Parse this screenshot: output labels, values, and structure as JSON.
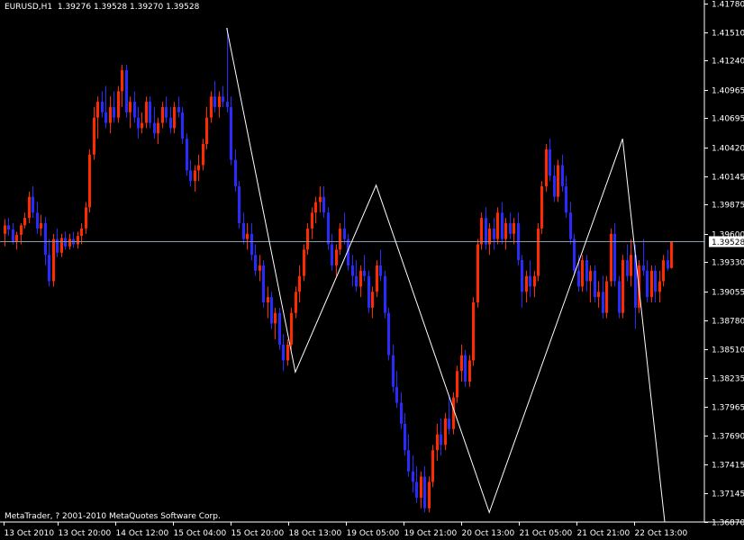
{
  "header": {
    "symbol_timeframe": "EURUSD,H1",
    "ohlc": "1.39276 1.39528 1.39270 1.39528"
  },
  "copyright": "MetaTrader, ? 2001-2010 MetaQuotes Software Corp.",
  "current_price_label": "1.39528",
  "colors": {
    "background": "#000000",
    "bull_candle": "#ff2a00",
    "bear_candle": "#2a2aff",
    "zigzag": "#ffffff",
    "price_line": "#8899aa",
    "axis": "#ffffff"
  },
  "chart_data": {
    "type": "candlestick",
    "symbol": "EURUSD",
    "timeframe": "H1",
    "ylim": [
      1.3687,
      1.4178
    ],
    "y_ticks": [
      "1.41780",
      "1.41510",
      "1.41240",
      "1.40965",
      "1.40695",
      "1.40420",
      "1.40145",
      "1.39875",
      "1.39600",
      "1.39330",
      "1.39055",
      "1.38780",
      "1.38510",
      "1.38235",
      "1.37965",
      "1.37690",
      "1.37415",
      "1.37145",
      "1.36870"
    ],
    "x_ticks": [
      "13 Oct 2010",
      "13 Oct 20:00",
      "14 Oct 12:00",
      "15 Oct 04:00",
      "15 Oct 20:00",
      "18 Oct 13:00",
      "19 Oct 05:00",
      "19 Oct 21:00",
      "20 Oct 13:00",
      "21 Oct 05:00",
      "21 Oct 21:00",
      "22 Oct 13:00"
    ],
    "current_price": 1.39528,
    "zigzag": [
      {
        "time": "15 Oct 04:00",
        "price": 1.4155
      },
      {
        "time": "15 Oct 22:00",
        "price": 1.3829
      },
      {
        "time": "18 Oct 14:00",
        "price": 1.4006
      },
      {
        "time": "19 Oct 22:00",
        "price": 1.3696
      },
      {
        "time": "21 Oct 06:00",
        "price": 1.405
      },
      {
        "time": "22 Oct 14:00",
        "price": 1.3687
      }
    ],
    "candles": [
      [
        1.396,
        1.3974,
        1.3948,
        1.3968
      ],
      [
        1.3968,
        1.3975,
        1.3958,
        1.3964
      ],
      [
        1.3964,
        1.397,
        1.395,
        1.3952
      ],
      [
        1.3952,
        1.3962,
        1.3945,
        1.3959
      ],
      [
        1.3959,
        1.397,
        1.395,
        1.3968
      ],
      [
        1.3968,
        1.398,
        1.3965,
        1.3975
      ],
      [
        1.3975,
        1.4,
        1.397,
        1.3995
      ],
      [
        1.3995,
        1.4005,
        1.3975,
        1.398
      ],
      [
        1.398,
        1.399,
        1.396,
        1.3965
      ],
      [
        1.3965,
        1.3978,
        1.3958,
        1.397
      ],
      [
        1.397,
        1.3976,
        1.393,
        1.394
      ],
      [
        1.394,
        1.3955,
        1.391,
        1.3915
      ],
      [
        1.3915,
        1.396,
        1.391,
        1.3955
      ],
      [
        1.3955,
        1.3965,
        1.3938,
        1.3942
      ],
      [
        1.3942,
        1.396,
        1.3938,
        1.3956
      ],
      [
        1.3956,
        1.3962,
        1.3945,
        1.3948
      ],
      [
        1.3948,
        1.396,
        1.3945,
        1.3955
      ],
      [
        1.3955,
        1.3962,
        1.3947,
        1.395
      ],
      [
        1.395,
        1.3962,
        1.3946,
        1.3958
      ],
      [
        1.3958,
        1.397,
        1.395,
        1.3965
      ],
      [
        1.3965,
        1.399,
        1.396,
        1.3985
      ],
      [
        1.3985,
        1.404,
        1.398,
        1.4035
      ],
      [
        1.4035,
        1.408,
        1.403,
        1.407
      ],
      [
        1.407,
        1.409,
        1.405,
        1.4085
      ],
      [
        1.4085,
        1.4095,
        1.407,
        1.4075
      ],
      [
        1.4075,
        1.41,
        1.406,
        1.4065
      ],
      [
        1.4065,
        1.409,
        1.4055,
        1.408
      ],
      [
        1.408,
        1.4095,
        1.4065,
        1.407
      ],
      [
        1.407,
        1.41,
        1.4065,
        1.4095
      ],
      [
        1.4095,
        1.412,
        1.408,
        1.4115
      ],
      [
        1.4115,
        1.412,
        1.407,
        1.4075
      ],
      [
        1.4075,
        1.409,
        1.406,
        1.4085
      ],
      [
        1.4085,
        1.4095,
        1.4065,
        1.407
      ],
      [
        1.407,
        1.408,
        1.405,
        1.406
      ],
      [
        1.406,
        1.4075,
        1.4055,
        1.4065
      ],
      [
        1.4065,
        1.409,
        1.406,
        1.4085
      ],
      [
        1.4085,
        1.409,
        1.406,
        1.4065
      ],
      [
        1.4065,
        1.408,
        1.405,
        1.4055
      ],
      [
        1.4055,
        1.407,
        1.4045,
        1.4065
      ],
      [
        1.4065,
        1.4085,
        1.406,
        1.408
      ],
      [
        1.408,
        1.409,
        1.4065,
        1.407
      ],
      [
        1.407,
        1.408,
        1.4055,
        1.406
      ],
      [
        1.406,
        1.4085,
        1.4055,
        1.408
      ],
      [
        1.408,
        1.409,
        1.407,
        1.4075
      ],
      [
        1.4075,
        1.408,
        1.4045,
        1.405
      ],
      [
        1.405,
        1.4055,
        1.4015,
        1.402
      ],
      [
        1.402,
        1.403,
        1.4005,
        1.401
      ],
      [
        1.401,
        1.4025,
        1.4,
        1.402
      ],
      [
        1.402,
        1.4035,
        1.401,
        1.4025
      ],
      [
        1.4025,
        1.405,
        1.402,
        1.4045
      ],
      [
        1.4045,
        1.408,
        1.404,
        1.407
      ],
      [
        1.407,
        1.4095,
        1.4065,
        1.409
      ],
      [
        1.409,
        1.4105,
        1.4075,
        1.408
      ],
      [
        1.408,
        1.4095,
        1.407,
        1.409
      ],
      [
        1.409,
        1.41,
        1.408,
        1.4085
      ],
      [
        1.4085,
        1.4155,
        1.4075,
        1.408
      ],
      [
        1.408,
        1.409,
        1.4025,
        1.403
      ],
      [
        1.403,
        1.404,
        1.4,
        1.4005
      ],
      [
        1.4005,
        1.401,
        1.3965,
        1.397
      ],
      [
        1.397,
        1.398,
        1.395,
        1.3955
      ],
      [
        1.3955,
        1.397,
        1.3945,
        1.396
      ],
      [
        1.396,
        1.397,
        1.3935,
        1.394
      ],
      [
        1.394,
        1.395,
        1.392,
        1.3925
      ],
      [
        1.3925,
        1.394,
        1.3915,
        1.393
      ],
      [
        1.393,
        1.3935,
        1.389,
        1.3895
      ],
      [
        1.3895,
        1.391,
        1.388,
        1.39
      ],
      [
        1.39,
        1.3905,
        1.387,
        1.3875
      ],
      [
        1.3875,
        1.389,
        1.386,
        1.3885
      ],
      [
        1.3885,
        1.389,
        1.385,
        1.3855
      ],
      [
        1.3855,
        1.3865,
        1.383,
        1.384
      ],
      [
        1.384,
        1.386,
        1.3835,
        1.3855
      ],
      [
        1.3855,
        1.389,
        1.385,
        1.3885
      ],
      [
        1.3885,
        1.391,
        1.388,
        1.3905
      ],
      [
        1.3905,
        1.393,
        1.3895,
        1.392
      ],
      [
        1.392,
        1.395,
        1.3915,
        1.3945
      ],
      [
        1.3945,
        1.397,
        1.394,
        1.3965
      ],
      [
        1.3965,
        1.3985,
        1.3955,
        1.398
      ],
      [
        1.398,
        1.3995,
        1.397,
        1.399
      ],
      [
        1.399,
        1.4005,
        1.398,
        1.3995
      ],
      [
        1.3995,
        1.4005,
        1.3975,
        1.398
      ],
      [
        1.398,
        1.3985,
        1.3945,
        1.395
      ],
      [
        1.395,
        1.396,
        1.3925,
        1.393
      ],
      [
        1.393,
        1.395,
        1.392,
        1.3945
      ],
      [
        1.3945,
        1.397,
        1.394,
        1.3965
      ],
      [
        1.3965,
        1.398,
        1.395,
        1.3955
      ],
      [
        1.3955,
        1.396,
        1.3925,
        1.393
      ],
      [
        1.393,
        1.394,
        1.391,
        1.392
      ],
      [
        1.392,
        1.3935,
        1.3905,
        1.391
      ],
      [
        1.391,
        1.393,
        1.39,
        1.3925
      ],
      [
        1.3925,
        1.394,
        1.3915,
        1.392
      ],
      [
        1.392,
        1.3925,
        1.3885,
        1.389
      ],
      [
        1.389,
        1.391,
        1.388,
        1.3905
      ],
      [
        1.3905,
        1.3935,
        1.39,
        1.393
      ],
      [
        1.393,
        1.3945,
        1.3915,
        1.392
      ],
      [
        1.392,
        1.3925,
        1.388,
        1.3885
      ],
      [
        1.3885,
        1.389,
        1.384,
        1.3845
      ],
      [
        1.3845,
        1.3855,
        1.381,
        1.3815
      ],
      [
        1.3815,
        1.383,
        1.3795,
        1.38
      ],
      [
        1.38,
        1.381,
        1.3775,
        1.378
      ],
      [
        1.378,
        1.379,
        1.375,
        1.3755
      ],
      [
        1.3755,
        1.377,
        1.373,
        1.3735
      ],
      [
        1.3735,
        1.375,
        1.3715,
        1.3725
      ],
      [
        1.3725,
        1.374,
        1.3705,
        1.371
      ],
      [
        1.371,
        1.3735,
        1.37,
        1.373
      ],
      [
        1.373,
        1.374,
        1.3696,
        1.37
      ],
      [
        1.37,
        1.373,
        1.3696,
        1.3725
      ],
      [
        1.3725,
        1.376,
        1.372,
        1.3755
      ],
      [
        1.3755,
        1.378,
        1.3745,
        1.377
      ],
      [
        1.377,
        1.3785,
        1.375,
        1.376
      ],
      [
        1.376,
        1.379,
        1.3755,
        1.3785
      ],
      [
        1.3785,
        1.3805,
        1.377,
        1.3775
      ],
      [
        1.3775,
        1.381,
        1.377,
        1.3805
      ],
      [
        1.3805,
        1.3835,
        1.38,
        1.383
      ],
      [
        1.383,
        1.3855,
        1.382,
        1.3845
      ],
      [
        1.3845,
        1.385,
        1.3815,
        1.382
      ],
      [
        1.382,
        1.3845,
        1.3815,
        1.384
      ],
      [
        1.384,
        1.39,
        1.3835,
        1.3895
      ],
      [
        1.3895,
        1.3955,
        1.389,
        1.395
      ],
      [
        1.395,
        1.398,
        1.3945,
        1.3975
      ],
      [
        1.3975,
        1.3985,
        1.3945,
        1.395
      ],
      [
        1.395,
        1.397,
        1.394,
        1.3965
      ],
      [
        1.3965,
        1.3975,
        1.3945,
        1.3955
      ],
      [
        1.3955,
        1.3985,
        1.395,
        1.398
      ],
      [
        1.398,
        1.399,
        1.395,
        1.3955
      ],
      [
        1.3955,
        1.3975,
        1.3945,
        1.397
      ],
      [
        1.397,
        1.398,
        1.3955,
        1.396
      ],
      [
        1.396,
        1.3975,
        1.395,
        1.397
      ],
      [
        1.397,
        1.398,
        1.393,
        1.3935
      ],
      [
        1.3935,
        1.394,
        1.389,
        1.3905
      ],
      [
        1.3905,
        1.3925,
        1.3895,
        1.392
      ],
      [
        1.392,
        1.3935,
        1.39,
        1.391
      ],
      [
        1.391,
        1.3925,
        1.39,
        1.392
      ],
      [
        1.392,
        1.397,
        1.3915,
        1.3965
      ],
      [
        1.3965,
        1.401,
        1.396,
        1.4005
      ],
      [
        1.4005,
        1.4045,
        1.4,
        1.404
      ],
      [
        1.404,
        1.405,
        1.401,
        1.4015
      ],
      [
        1.4015,
        1.4025,
        1.399,
        1.3995
      ],
      [
        1.3995,
        1.403,
        1.399,
        1.4025
      ],
      [
        1.4025,
        1.4035,
        1.4,
        1.4005
      ],
      [
        1.4005,
        1.4015,
        1.3975,
        1.398
      ],
      [
        1.398,
        1.399,
        1.395,
        1.3955
      ],
      [
        1.3955,
        1.396,
        1.392,
        1.3925
      ],
      [
        1.3925,
        1.394,
        1.3905,
        1.391
      ],
      [
        1.391,
        1.394,
        1.3905,
        1.3935
      ],
      [
        1.3935,
        1.394,
        1.3905,
        1.3915
      ],
      [
        1.3915,
        1.393,
        1.3895,
        1.3925
      ],
      [
        1.3925,
        1.393,
        1.3895,
        1.39
      ],
      [
        1.39,
        1.3915,
        1.389,
        1.3905
      ],
      [
        1.3905,
        1.392,
        1.388,
        1.3885
      ],
      [
        1.3885,
        1.392,
        1.388,
        1.3915
      ],
      [
        1.3915,
        1.3965,
        1.391,
        1.396
      ],
      [
        1.396,
        1.397,
        1.391,
        1.3915
      ],
      [
        1.3915,
        1.392,
        1.388,
        1.3885
      ],
      [
        1.3885,
        1.394,
        1.388,
        1.3935
      ],
      [
        1.3935,
        1.395,
        1.3915,
        1.392
      ],
      [
        1.392,
        1.3955,
        1.391,
        1.394
      ],
      [
        1.394,
        1.395,
        1.387,
        1.389
      ],
      [
        1.389,
        1.3935,
        1.3885,
        1.393
      ],
      [
        1.393,
        1.3955,
        1.392,
        1.3925
      ],
      [
        1.3925,
        1.3935,
        1.3895,
        1.39
      ],
      [
        1.39,
        1.393,
        1.3895,
        1.3925
      ],
      [
        1.3925,
        1.393,
        1.3895,
        1.3905
      ],
      [
        1.3905,
        1.3925,
        1.3895,
        1.3915
      ],
      [
        1.3915,
        1.394,
        1.391,
        1.3935
      ],
      [
        1.3935,
        1.3945,
        1.3925,
        1.3927
      ],
      [
        1.39276,
        1.39528,
        1.3927,
        1.39528
      ]
    ]
  }
}
